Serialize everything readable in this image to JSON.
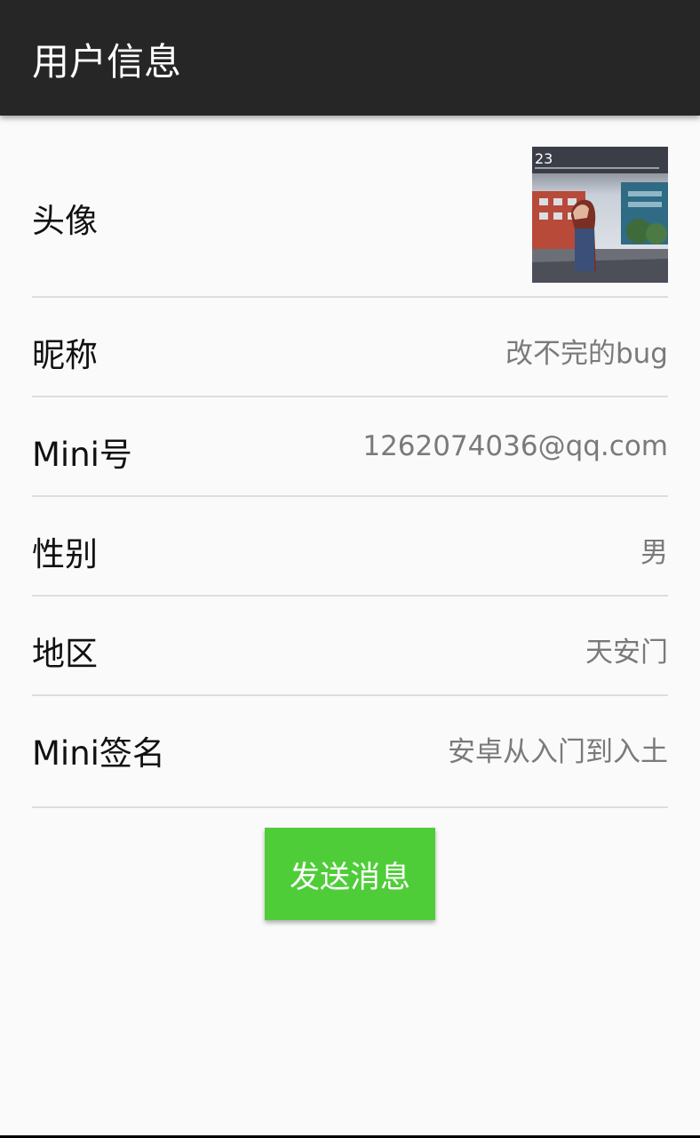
{
  "toolbar": {
    "title": "用户信息",
    "background": "#262626"
  },
  "rows": {
    "avatar": {
      "label": "头像"
    },
    "nickname": {
      "label": "昵称",
      "value": "改不完的bug"
    },
    "mini_id": {
      "label": "Mini号",
      "value": "1262074036@qq.com"
    },
    "gender": {
      "label": "性别",
      "value": "男"
    },
    "region": {
      "label": "地区",
      "value": "天安门"
    },
    "signature": {
      "label": "Mini签名",
      "value": "安卓从入门到入土"
    }
  },
  "avatar_image": {
    "overlay_number": "23"
  },
  "send_button": {
    "label": "发送消息",
    "color": "#4fcd39"
  }
}
